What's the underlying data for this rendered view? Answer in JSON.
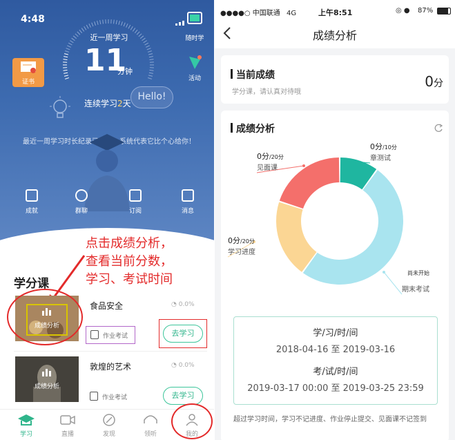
{
  "left": {
    "status_time": "4:48",
    "tabs_right": {
      "random": "随时学",
      "activity": "活动"
    },
    "cert_label": "证书",
    "week_label": "近一周学习",
    "minutes_value": "11",
    "minutes_unit": "分钟",
    "streak_prefix": "连续学习",
    "streak_days": "2",
    "streak_suffix": "天",
    "hello_bubble": "Hello!",
    "record_text": "最近一周学习时长纪录已刷新！系统代表它比个心给你！",
    "quick_actions": [
      {
        "label": "成就",
        "name": "achievement"
      },
      {
        "label": "群聊",
        "name": "group-chat"
      },
      {
        "label": "订阅",
        "name": "subscribe"
      },
      {
        "label": "消息",
        "name": "message"
      }
    ],
    "section_title": "学分课",
    "annotation": [
      "点击成绩分析，",
      "查看当前分数，",
      "学习、考试时间"
    ],
    "courses": [
      {
        "title": "食品安全",
        "progress": "0.0%",
        "thumb_label": "成绩分析",
        "hw_label": "作业考试",
        "go_label": "去学习"
      },
      {
        "title": "敦煌的艺术",
        "progress": "0.0%",
        "thumb_label": "成绩分析",
        "hw_label": "作业考试",
        "go_label": "去学习"
      }
    ],
    "bottom_nav": [
      "学习",
      "直播",
      "发现",
      "领听",
      "我的"
    ]
  },
  "right": {
    "status_carrier": "●●●●○ 中国联通",
    "status_network": "4G",
    "status_time": "上午8:51",
    "status_battery": "87%",
    "nav_title": "成绩分析",
    "current_title": "当前成绩",
    "current_sub": "学分课，请认真对待哦",
    "current_score": "0",
    "current_unit": "分",
    "analysis_title": "成绩分析",
    "chart_data": {
      "type": "pie",
      "title": "",
      "donut": true,
      "slices": [
        {
          "name": "章测试",
          "score": "0分",
          "max": "/10分",
          "share": 10,
          "color": "#1fb6a0"
        },
        {
          "name": "期末考试",
          "score": "",
          "max": "",
          "note": "尚未开始",
          "share": 50,
          "color": "#a9e4ef"
        },
        {
          "name": "学习进度",
          "score": "0分",
          "max": "/20分",
          "share": 20,
          "color": "#fbd694"
        },
        {
          "name": "见面课",
          "score": "0分",
          "max": "/20分",
          "share": 20,
          "color": "#f46f6b"
        }
      ]
    },
    "study_time_label": "学/习/时/间",
    "study_time_value": "2018-04-16 至 2019-03-16",
    "exam_time_label": "考/试/时/间",
    "exam_time_value": "2019-03-17 00:00 至 2019-03-25 23:59",
    "footer_note": "超过学习时间，学习不记进度、作业停止提交、见面课不记签到"
  }
}
